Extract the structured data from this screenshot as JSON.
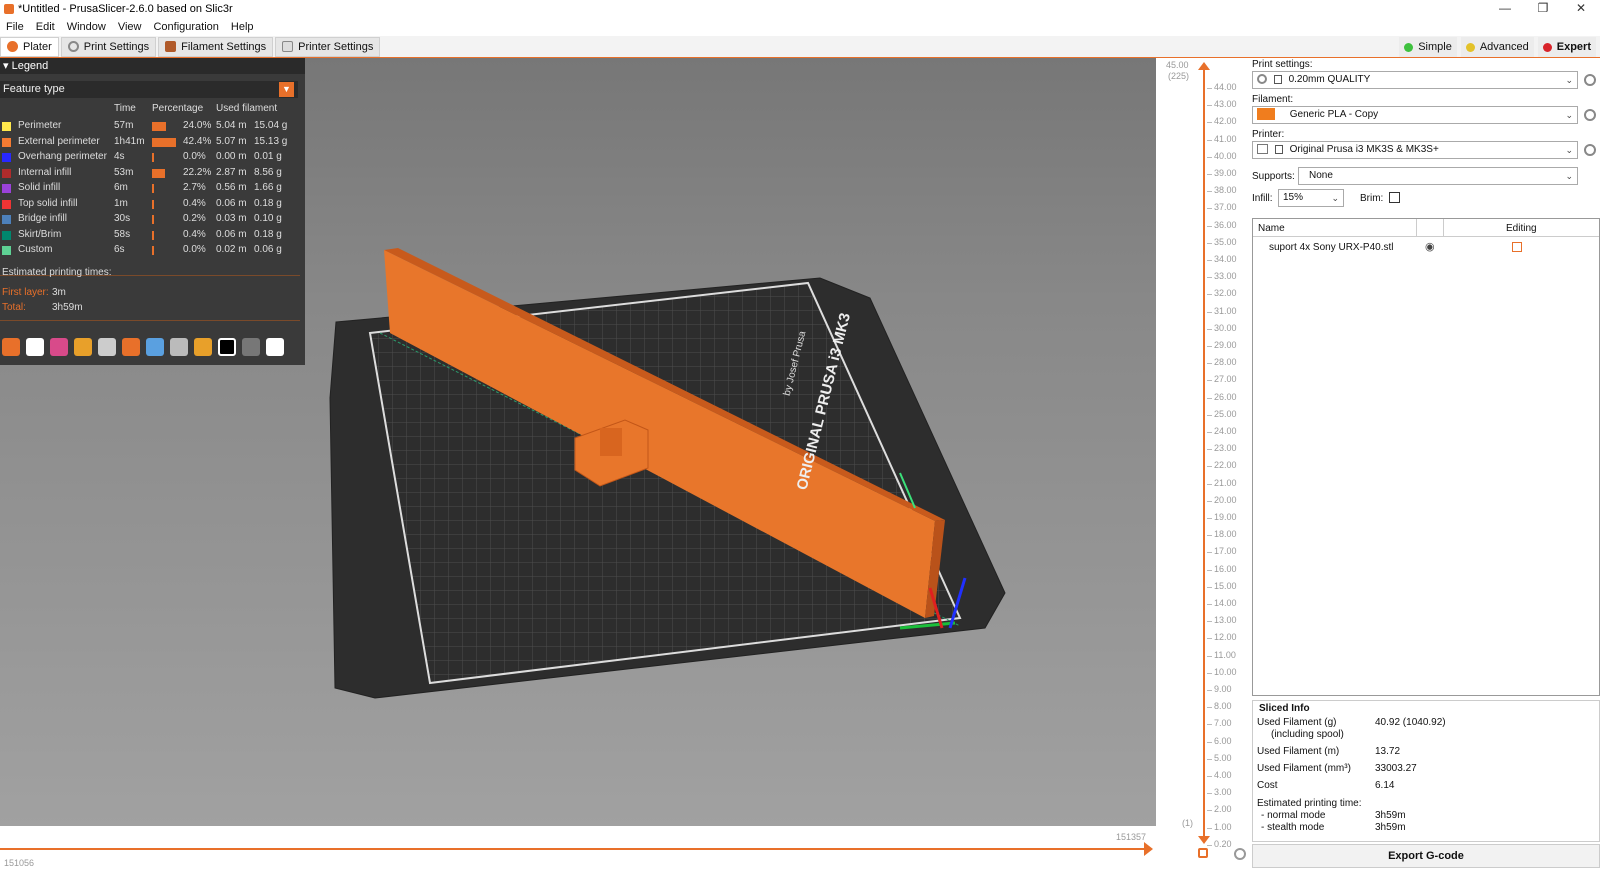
{
  "window": {
    "title": "*Untitled - PrusaSlicer-2.6.0 based on Slic3r",
    "min": "—",
    "max": "❐",
    "close": "✕"
  },
  "menu": [
    "File",
    "Edit",
    "Window",
    "View",
    "Configuration",
    "Help"
  ],
  "tabs": [
    {
      "label": "Plater",
      "icon": "plater-icon",
      "color": "#e8702a"
    },
    {
      "label": "Print Settings",
      "icon": "gear-icon",
      "color": "#888888"
    },
    {
      "label": "Filament Settings",
      "icon": "spool-icon",
      "color": "#b05a2a"
    },
    {
      "label": "Printer Settings",
      "icon": "printer-icon",
      "color": "#888888"
    }
  ],
  "modes": [
    {
      "label": "Simple",
      "color": "#3ec13e"
    },
    {
      "label": "Advanced",
      "color": "#e3c22a"
    },
    {
      "label": "Expert",
      "color": "#d8232a"
    }
  ],
  "legend": {
    "title": "Legend",
    "feature_type": "Feature type",
    "col_time": "Time",
    "col_percentage": "Percentage",
    "col_used": "Used filament",
    "rows": [
      {
        "name": "Perimeter",
        "color": "#ffe84c",
        "time": "57m",
        "pct": "24.0%",
        "pct_value": 24.0,
        "m": "5.04 m",
        "g": "15.04 g"
      },
      {
        "name": "External perimeter",
        "color": "#f57b32",
        "time": "1h41m",
        "pct": "42.4%",
        "pct_value": 42.4,
        "m": "5.07 m",
        "g": "15.13 g"
      },
      {
        "name": "Overhang perimeter",
        "color": "#2828ff",
        "time": "4s",
        "pct": "0.0%",
        "pct_value": 0.0,
        "m": "0.00 m",
        "g": "0.01 g"
      },
      {
        "name": "Internal infill",
        "color": "#b02b2b",
        "time": "53m",
        "pct": "22.2%",
        "pct_value": 22.2,
        "m": "2.87 m",
        "g": "8.56 g"
      },
      {
        "name": "Solid infill",
        "color": "#9a42d8",
        "time": "6m",
        "pct": "2.7%",
        "pct_value": 2.7,
        "m": "0.56 m",
        "g": "1.66 g"
      },
      {
        "name": "Top solid infill",
        "color": "#f03434",
        "time": "1m",
        "pct": "0.4%",
        "pct_value": 0.4,
        "m": "0.06 m",
        "g": "0.18 g"
      },
      {
        "name": "Bridge infill",
        "color": "#4d80ba",
        "time": "30s",
        "pct": "0.2%",
        "pct_value": 0.2,
        "m": "0.03 m",
        "g": "0.10 g"
      },
      {
        "name": "Skirt/Brim",
        "color": "#00876e",
        "time": "58s",
        "pct": "0.4%",
        "pct_value": 0.4,
        "m": "0.06 m",
        "g": "0.18 g"
      },
      {
        "name": "Custom",
        "color": "#5ed194",
        "time": "6s",
        "pct": "0.0%",
        "pct_value": 0.0,
        "m": "0.02 m",
        "g": "0.06 g"
      }
    ],
    "estimated": "Estimated printing times:",
    "first_layer_label": "First layer:",
    "first_layer": "3m",
    "total_label": "Total:",
    "total": "3h59m"
  },
  "bed": {
    "brand": "ORIGINAL PRUSA i3 MK3",
    "by": "by Josef Prusa"
  },
  "layer_slider": {
    "top_value": "45.00",
    "top_layer": "(225)",
    "bottom_layer": "(1)",
    "ticks": [
      "44.00",
      "43.00",
      "42.00",
      "41.00",
      "40.00",
      "39.00",
      "38.00",
      "37.00",
      "36.00",
      "35.00",
      "34.00",
      "33.00",
      "32.00",
      "31.00",
      "30.00",
      "29.00",
      "28.00",
      "27.00",
      "26.00",
      "25.00",
      "24.00",
      "23.00",
      "22.00",
      "21.00",
      "20.00",
      "19.00",
      "18.00",
      "17.00",
      "16.00",
      "15.00",
      "14.00",
      "13.00",
      "12.00",
      "11.00",
      "10.00",
      "9.00",
      "8.00",
      "7.00",
      "6.00",
      "5.00",
      "4.00",
      "3.00",
      "2.00",
      "1.00",
      "0.20"
    ]
  },
  "move_slider": {
    "left": "151056",
    "right": "151357"
  },
  "right": {
    "print_settings_label": "Print settings:",
    "print_settings": "0.20mm QUALITY",
    "filament_label": "Filament:",
    "filament": "Generic PLA - Copy",
    "filament_color": "#f07d1e",
    "printer_label": "Printer:",
    "printer": "Original Prusa i3 MK3S & MK3S+",
    "supports_label": "Supports:",
    "supports": "None",
    "infill_label": "Infill:",
    "infill": "15%",
    "brim_label": "Brim:",
    "col_name": "Name",
    "col_editing": "Editing",
    "object_name": "suport 4x Sony URX-P40.stl"
  },
  "sliced": {
    "title": "Sliced Info",
    "rows": [
      {
        "label": "Used Filament (g)",
        "sub": "(including spool)",
        "value": "40.92 (1040.92)"
      },
      {
        "label": "Used Filament (m)",
        "value": "13.72"
      },
      {
        "label": "Used Filament (mm³)",
        "value": "33003.27"
      },
      {
        "label": "Cost",
        "value": "6.14"
      }
    ],
    "est_label": "Estimated printing time:",
    "normal_label": "- normal mode",
    "normal": "3h59m",
    "stealth_label": "- stealth mode",
    "stealth": "3h59m"
  },
  "export_label": "Export G-code"
}
